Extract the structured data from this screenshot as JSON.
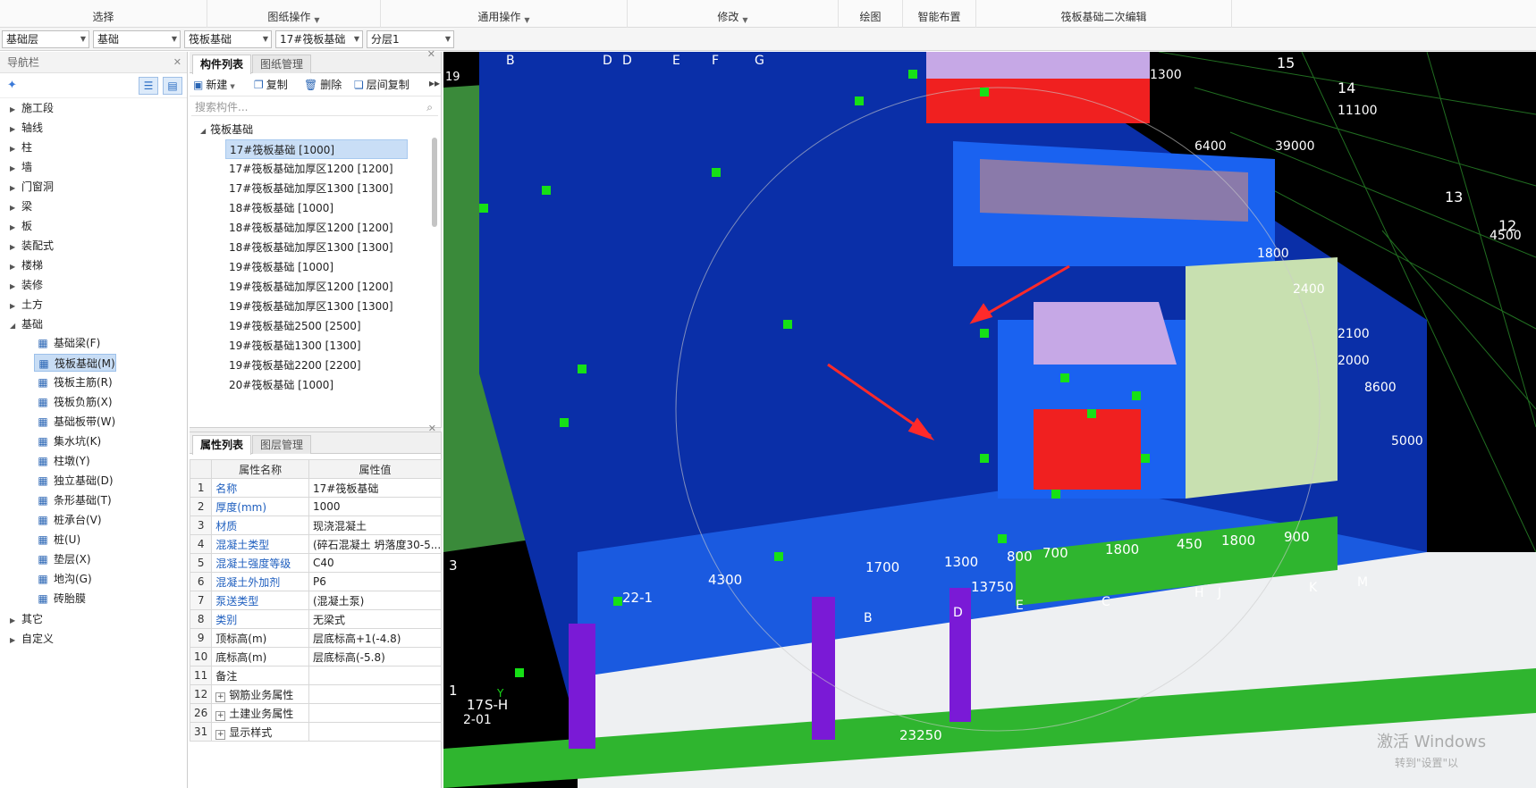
{
  "ribbon": {
    "groups": [
      {
        "label": "选择",
        "caret": false
      },
      {
        "label": "图纸操作",
        "caret": true
      },
      {
        "label": "通用操作",
        "caret": true
      },
      {
        "label": "修改",
        "caret": true
      },
      {
        "label": "绘图",
        "caret": false
      },
      {
        "label": "智能布置",
        "caret": false
      },
      {
        "label": "筏板基础二次编辑",
        "caret": false
      }
    ]
  },
  "dropdowns": {
    "floor": "基础层",
    "category": "基础",
    "type": "筏板基础",
    "component": "17#筏板基础",
    "layer": "分层1"
  },
  "nav": {
    "title": "导航栏",
    "items": [
      {
        "label": "施工段",
        "expanded": false
      },
      {
        "label": "轴线",
        "expanded": false
      },
      {
        "label": "柱",
        "expanded": false
      },
      {
        "label": "墙",
        "expanded": false
      },
      {
        "label": "门窗洞",
        "expanded": false
      },
      {
        "label": "梁",
        "expanded": false
      },
      {
        "label": "板",
        "expanded": false
      },
      {
        "label": "装配式",
        "expanded": false
      },
      {
        "label": "楼梯",
        "expanded": false
      },
      {
        "label": "装修",
        "expanded": false
      },
      {
        "label": "土方",
        "expanded": false
      },
      {
        "label": "基础",
        "expanded": true
      }
    ],
    "foundation_children": [
      {
        "label": "基础梁(F)",
        "icon": "pencil-icon"
      },
      {
        "label": "筏板基础(M)",
        "icon": "grid-icon",
        "selected": true
      },
      {
        "label": "筏板主筋(R)",
        "icon": "rebar-icon"
      },
      {
        "label": "筏板负筋(X)",
        "icon": "rebar-neg-icon"
      },
      {
        "label": "基础板带(W)",
        "icon": "strip-icon"
      },
      {
        "label": "集水坑(K)",
        "icon": "sump-icon"
      },
      {
        "label": "柱墩(Y)",
        "icon": "pier-icon"
      },
      {
        "label": "独立基础(D)",
        "icon": "isolated-footing-icon"
      },
      {
        "label": "条形基础(T)",
        "icon": "strip-footing-icon"
      },
      {
        "label": "桩承台(V)",
        "icon": "pile-cap-icon"
      },
      {
        "label": "桩(U)",
        "icon": "pile-icon"
      },
      {
        "label": "垫层(X)",
        "icon": "cushion-icon"
      },
      {
        "label": "地沟(G)",
        "icon": "trench-icon"
      },
      {
        "label": "砖胎膜",
        "icon": "brick-mold-icon"
      }
    ],
    "tail_items": [
      {
        "label": "其它"
      },
      {
        "label": "自定义"
      }
    ]
  },
  "component_panel": {
    "tabs": [
      "构件列表",
      "图纸管理"
    ],
    "toolbar": {
      "new": "新建",
      "copy": "复制",
      "delete": "删除",
      "floor_copy": "层间复制"
    },
    "search_placeholder": "搜索构件...",
    "root": "筏板基础",
    "items": [
      "17#筏板基础 [1000]",
      "17#筏板基础加厚区1200 [1200]",
      "17#筏板基础加厚区1300 [1300]",
      "18#筏板基础 [1000]",
      "18#筏板基础加厚区1200 [1200]",
      "18#筏板基础加厚区1300 [1300]",
      "19#筏板基础 [1000]",
      "19#筏板基础加厚区1200 [1200]",
      "19#筏板基础加厚区1300 [1300]",
      "19#筏板基础2500 [2500]",
      "19#筏板基础1300 [1300]",
      "19#筏板基础2200 [2200]",
      "20#筏板基础 [1000]"
    ]
  },
  "property_panel": {
    "tabs": [
      "属性列表",
      "图层管理"
    ],
    "headers": [
      "属性名称",
      "属性值"
    ],
    "rows": [
      {
        "n": "1",
        "name": "名称",
        "value": "17#筏板基础",
        "blue": true,
        "exp": false
      },
      {
        "n": "2",
        "name": "厚度(mm)",
        "value": "1000",
        "blue": true,
        "exp": false
      },
      {
        "n": "3",
        "name": "材质",
        "value": "现浇混凝土",
        "blue": true,
        "exp": false
      },
      {
        "n": "4",
        "name": "混凝土类型",
        "value": "(碎石混凝土 坍落度30-5...",
        "blue": true,
        "exp": false
      },
      {
        "n": "5",
        "name": "混凝土强度等级",
        "value": "C40",
        "blue": true,
        "exp": false
      },
      {
        "n": "6",
        "name": "混凝土外加剂",
        "value": "P6",
        "blue": true,
        "exp": false
      },
      {
        "n": "7",
        "name": "泵送类型",
        "value": "(混凝土泵)",
        "blue": true,
        "exp": false
      },
      {
        "n": "8",
        "name": "类别",
        "value": "无梁式",
        "blue": true,
        "exp": false
      },
      {
        "n": "9",
        "name": "顶标高(m)",
        "value": "层底标高+1(-4.8)",
        "blue": false,
        "exp": false
      },
      {
        "n": "10",
        "name": "底标高(m)",
        "value": "层底标高(-5.8)",
        "blue": false,
        "exp": false
      },
      {
        "n": "11",
        "name": "备注",
        "value": "",
        "blue": false,
        "exp": false
      },
      {
        "n": "12",
        "name": "钢筋业务属性",
        "value": "",
        "blue": false,
        "exp": true
      },
      {
        "n": "26",
        "name": "土建业务属性",
        "value": "",
        "blue": false,
        "exp": true
      },
      {
        "n": "31",
        "name": "显示样式",
        "value": "",
        "blue": false,
        "exp": true
      }
    ]
  },
  "viewport": {
    "labels": [
      "B",
      "D",
      "D",
      "E",
      "F",
      "G",
      "15",
      "14",
      "13",
      "12",
      "19",
      "1300",
      "11100",
      "39000",
      "6400",
      "4500",
      "1800",
      "2400",
      "2100",
      "2000",
      "8600",
      "5000",
      "4300",
      "1700",
      "1300",
      "800",
      "700",
      "1800",
      "450",
      "1800",
      "900",
      "22-1",
      "13750",
      "23250",
      "B",
      "D",
      "E",
      "C",
      "H",
      "J",
      "K",
      "M",
      "3",
      "1",
      "17",
      "S-H",
      "2-01",
      "Y"
    ],
    "watermark": "激活 Windows",
    "watermark_sub": "转到\"设置\"以",
    "colors": {
      "blue_slab": "#0a2fa8",
      "bright_blue": "#1a62f0",
      "green": "#2fb52f",
      "purple": "#7a1ad6",
      "red": "#f02020",
      "lavender": "#c6a8e6"
    }
  }
}
